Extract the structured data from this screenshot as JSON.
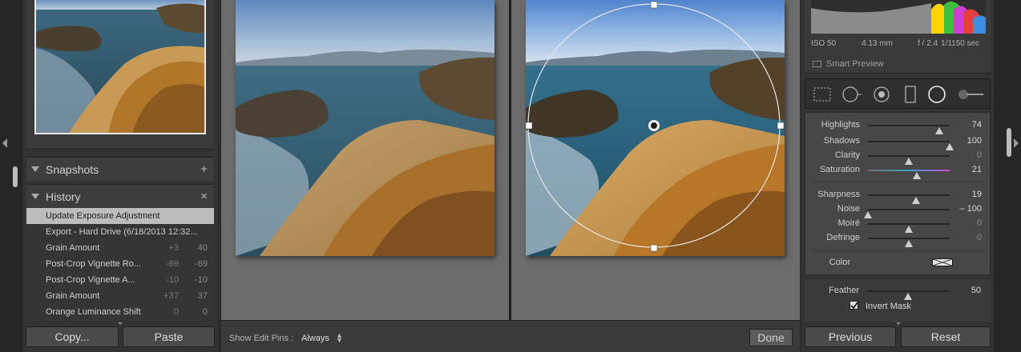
{
  "left": {
    "snapshots": {
      "title": "Snapshots",
      "action": "+"
    },
    "history": {
      "title": "History",
      "action": "×",
      "items": [
        {
          "name": "Update Exposure Adjustment",
          "a": "",
          "b": "",
          "selected": true
        },
        {
          "name": "Export - Hard Drive (6/18/2013 12:32...",
          "a": "",
          "b": ""
        },
        {
          "name": "Grain Amount",
          "a": "+3",
          "b": "40"
        },
        {
          "name": "Post-Crop Vignette Ro...",
          "a": "-69",
          "b": "-69"
        },
        {
          "name": "Post-Crop Vignette A...",
          "a": "-10",
          "b": "-10"
        },
        {
          "name": "Grain Amount",
          "a": "+37",
          "b": "37"
        },
        {
          "name": "Orange Luminance Shift",
          "a": "0",
          "b": "0"
        }
      ]
    },
    "copy_label": "Copy...",
    "paste_label": "Paste"
  },
  "toolbar": {
    "show_pins_label": "Show Edit Pins :",
    "show_pins_value": "Always",
    "done_label": "Done"
  },
  "right": {
    "exif": {
      "iso": "ISO 50",
      "focal": "4.13 mm",
      "aperture": "f / 2.4",
      "shutter": "1/1150 sec"
    },
    "smart_preview": "Smart Preview",
    "tools": [
      "crop-overlay-icon",
      "spot-removal-icon",
      "red-eye-icon",
      "graduated-filter-icon",
      "radial-filter-icon",
      "adjustment-brush-icon"
    ],
    "adjustments": [
      {
        "label": "Highlights",
        "value": "74",
        "pos": 0.87,
        "dim": false
      },
      {
        "label": "Shadows",
        "value": "100",
        "pos": 1.0,
        "dim": false
      },
      {
        "label": "Clarity",
        "value": "0",
        "pos": 0.5,
        "dim": true
      },
      {
        "label": "Saturation",
        "value": "21",
        "pos": 0.6,
        "dim": false
      },
      {
        "label": "Sharpness",
        "value": "19",
        "pos": 0.59,
        "dim": false
      },
      {
        "label": "Noise",
        "value": "– 100",
        "pos": 0.0,
        "dim": false
      },
      {
        "label": "Moiré",
        "value": "0",
        "pos": 0.5,
        "dim": true
      },
      {
        "label": "Defringe",
        "value": "0",
        "pos": 0.5,
        "dim": true
      }
    ],
    "color_label": "Color",
    "feather": {
      "label": "Feather",
      "value": "50",
      "pos": 0.5
    },
    "invert_mask_label": "Invert Mask",
    "previous_label": "Previous",
    "reset_label": "Reset"
  }
}
